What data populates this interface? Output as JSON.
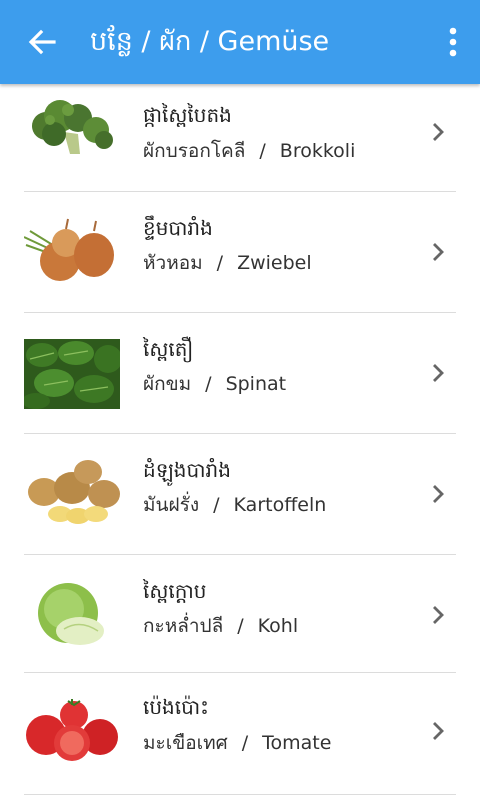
{
  "header": {
    "title": "បន្លែ / ผัก / Gemüse",
    "back_icon": "arrow-back-icon",
    "menu_icon": "overflow-menu-icon",
    "color": "#3d9ded"
  },
  "items": [
    {
      "km": "ផ្កាស្ពៃបៃតង",
      "th": "ผักบรอกโคลี",
      "de": "Brokkoli",
      "image": "broccoli"
    },
    {
      "km": "ខ្ទឹមបារាំង",
      "th": "หัวหอม",
      "de": "Zwiebel",
      "image": "onion"
    },
    {
      "km": "ស្ពៃតឿ",
      "th": "ผักขม",
      "de": "Spinat",
      "image": "spinach"
    },
    {
      "km": "ដំឡូងបារាំង",
      "th": "มันฝรั่ง",
      "de": "Kartoffeln",
      "image": "potato"
    },
    {
      "km": "ស្ពៃក្តោប",
      "th": "กะหล่ำปลี",
      "de": "Kohl",
      "image": "cabbage"
    },
    {
      "km": "ប៉េងប៉ោះ",
      "th": "มะเขือเทศ",
      "de": "Tomate",
      "image": "tomato"
    }
  ],
  "separator": "/"
}
